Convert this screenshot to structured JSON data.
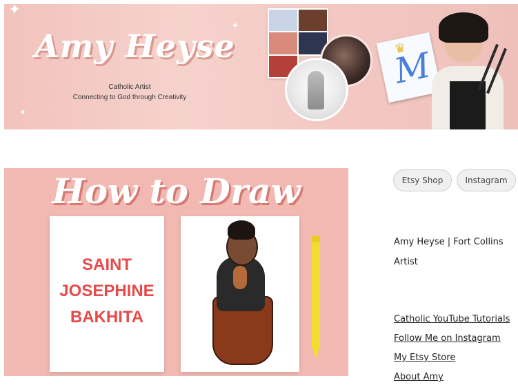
{
  "banner": {
    "title": "Amy Heyse",
    "subtitle_line1": "Catholic Artist",
    "subtitle_line2": "Connecting to God through Creativity"
  },
  "post": {
    "title": "How to Draw",
    "saint_name_line1": "SAINT",
    "saint_name_line2": "JOSEPHINE",
    "saint_name_line3": "BAKHITA"
  },
  "sidebar": {
    "buttons": [
      {
        "label": "Etsy Shop"
      },
      {
        "label": "Instagram"
      }
    ],
    "about_line1": "Amy Heyse | Fort Collins",
    "about_line2": "Artist",
    "links": [
      {
        "label": "Catholic YouTube Tutorials"
      },
      {
        "label": "Follow Me on Instagram"
      },
      {
        "label": "My Etsy Store"
      },
      {
        "label": "About Amy"
      }
    ]
  },
  "colors": {
    "banner_bg": "#f3c8c3",
    "post_bg": "#f2b9b3",
    "saint_text": "#e64a4a",
    "pencil": "#f2dc2c"
  }
}
